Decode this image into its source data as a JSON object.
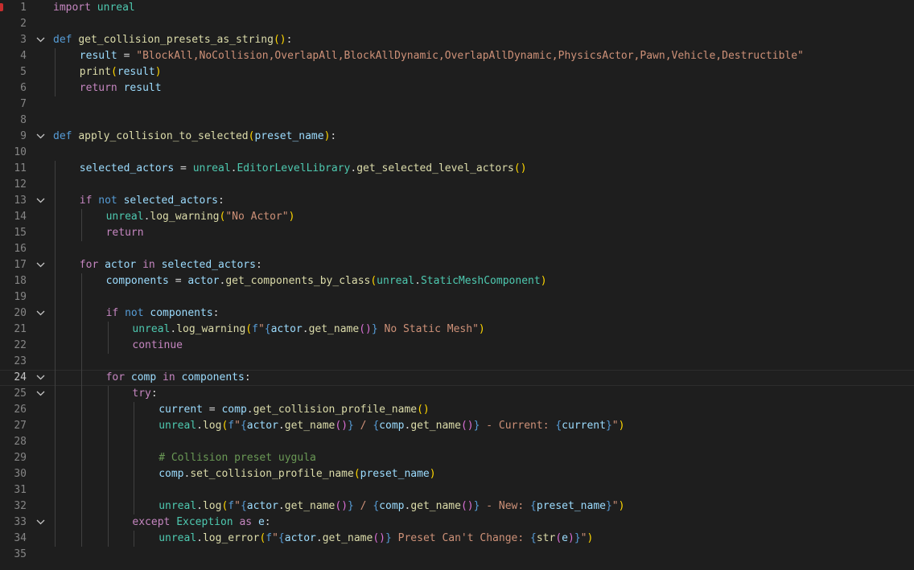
{
  "editor": {
    "language": "python",
    "active_line": 24,
    "breakpoint_line": 1,
    "lines": [
      {
        "n": 1,
        "indent": 0,
        "fold": false,
        "tokens": [
          [
            "ctl",
            "import"
          ],
          [
            "pl",
            " "
          ],
          [
            "cls",
            "unreal"
          ]
        ]
      },
      {
        "n": 2,
        "indent": 0,
        "fold": false,
        "tokens": []
      },
      {
        "n": 3,
        "indent": 0,
        "fold": true,
        "tokens": [
          [
            "kw",
            "def"
          ],
          [
            "pl",
            " "
          ],
          [
            "fn",
            "get_collision_presets_as_string"
          ],
          [
            "b1",
            "()"
          ],
          [
            "pl",
            ":"
          ]
        ]
      },
      {
        "n": 4,
        "indent": 1,
        "fold": false,
        "tokens": [
          [
            "var",
            "result"
          ],
          [
            "pl",
            " = "
          ],
          [
            "str",
            "\"BlockAll,NoCollision,OverlapAll,BlockAllDynamic,OverlapAllDynamic,PhysicsActor,Pawn,Vehicle,Destructible\""
          ]
        ]
      },
      {
        "n": 5,
        "indent": 1,
        "fold": false,
        "tokens": [
          [
            "fn",
            "print"
          ],
          [
            "b1",
            "("
          ],
          [
            "var",
            "result"
          ],
          [
            "b1",
            ")"
          ]
        ]
      },
      {
        "n": 6,
        "indent": 1,
        "fold": false,
        "tokens": [
          [
            "ctl",
            "return"
          ],
          [
            "pl",
            " "
          ],
          [
            "var",
            "result"
          ]
        ]
      },
      {
        "n": 7,
        "indent": 0,
        "fold": false,
        "tokens": []
      },
      {
        "n": 8,
        "indent": 0,
        "fold": false,
        "tokens": []
      },
      {
        "n": 9,
        "indent": 0,
        "fold": true,
        "tokens": [
          [
            "kw",
            "def"
          ],
          [
            "pl",
            " "
          ],
          [
            "fn",
            "apply_collision_to_selected"
          ],
          [
            "b1",
            "("
          ],
          [
            "var",
            "preset_name"
          ],
          [
            "b1",
            ")"
          ],
          [
            "pl",
            ":"
          ]
        ]
      },
      {
        "n": 10,
        "indent": 0,
        "fold": false,
        "tokens": []
      },
      {
        "n": 11,
        "indent": 1,
        "fold": false,
        "tokens": [
          [
            "var",
            "selected_actors"
          ],
          [
            "pl",
            " = "
          ],
          [
            "cls",
            "unreal"
          ],
          [
            "pl",
            "."
          ],
          [
            "cls",
            "EditorLevelLibrary"
          ],
          [
            "pl",
            "."
          ],
          [
            "fn",
            "get_selected_level_actors"
          ],
          [
            "b1",
            "()"
          ]
        ]
      },
      {
        "n": 12,
        "indent": 0,
        "fold": false,
        "tokens": []
      },
      {
        "n": 13,
        "indent": 1,
        "fold": true,
        "tokens": [
          [
            "ctl",
            "if"
          ],
          [
            "pl",
            " "
          ],
          [
            "kw",
            "not"
          ],
          [
            "pl",
            " "
          ],
          [
            "var",
            "selected_actors"
          ],
          [
            "pl",
            ":"
          ]
        ]
      },
      {
        "n": 14,
        "indent": 2,
        "fold": false,
        "tokens": [
          [
            "cls",
            "unreal"
          ],
          [
            "pl",
            "."
          ],
          [
            "fn",
            "log_warning"
          ],
          [
            "b1",
            "("
          ],
          [
            "str",
            "\"No Actor\""
          ],
          [
            "b1",
            ")"
          ]
        ]
      },
      {
        "n": 15,
        "indent": 2,
        "fold": false,
        "tokens": [
          [
            "ctl",
            "return"
          ]
        ]
      },
      {
        "n": 16,
        "indent": 0,
        "fold": false,
        "tokens": []
      },
      {
        "n": 17,
        "indent": 1,
        "fold": true,
        "tokens": [
          [
            "ctl",
            "for"
          ],
          [
            "pl",
            " "
          ],
          [
            "var",
            "actor"
          ],
          [
            "pl",
            " "
          ],
          [
            "ctl",
            "in"
          ],
          [
            "pl",
            " "
          ],
          [
            "var",
            "selected_actors"
          ],
          [
            "pl",
            ":"
          ]
        ]
      },
      {
        "n": 18,
        "indent": 2,
        "fold": false,
        "tokens": [
          [
            "var",
            "components"
          ],
          [
            "pl",
            " = "
          ],
          [
            "var",
            "actor"
          ],
          [
            "pl",
            "."
          ],
          [
            "fn",
            "get_components_by_class"
          ],
          [
            "b1",
            "("
          ],
          [
            "cls",
            "unreal"
          ],
          [
            "pl",
            "."
          ],
          [
            "cls",
            "StaticMeshComponent"
          ],
          [
            "b1",
            ")"
          ]
        ]
      },
      {
        "n": 19,
        "indent": 0,
        "fold": false,
        "tokens": []
      },
      {
        "n": 20,
        "indent": 2,
        "fold": true,
        "tokens": [
          [
            "ctl",
            "if"
          ],
          [
            "pl",
            " "
          ],
          [
            "kw",
            "not"
          ],
          [
            "pl",
            " "
          ],
          [
            "var",
            "components"
          ],
          [
            "pl",
            ":"
          ]
        ]
      },
      {
        "n": 21,
        "indent": 3,
        "fold": false,
        "tokens": [
          [
            "cls",
            "unreal"
          ],
          [
            "pl",
            "."
          ],
          [
            "fn",
            "log_warning"
          ],
          [
            "b1",
            "("
          ],
          [
            "kw",
            "f"
          ],
          [
            "str",
            "\""
          ],
          [
            "kw",
            "{"
          ],
          [
            "var",
            "actor"
          ],
          [
            "pl",
            "."
          ],
          [
            "fn",
            "get_name"
          ],
          [
            "b2",
            "()"
          ],
          [
            "kw",
            "}"
          ],
          [
            "str",
            " No Static Mesh\""
          ],
          [
            "b1",
            ")"
          ]
        ]
      },
      {
        "n": 22,
        "indent": 3,
        "fold": false,
        "tokens": [
          [
            "ctl",
            "continue"
          ]
        ]
      },
      {
        "n": 23,
        "indent": 0,
        "fold": false,
        "tokens": []
      },
      {
        "n": 24,
        "indent": 2,
        "fold": true,
        "tokens": [
          [
            "ctl",
            "for"
          ],
          [
            "pl",
            " "
          ],
          [
            "var",
            "comp"
          ],
          [
            "pl",
            " "
          ],
          [
            "ctl",
            "in"
          ],
          [
            "pl",
            " "
          ],
          [
            "var",
            "components"
          ],
          [
            "pl",
            ":"
          ]
        ]
      },
      {
        "n": 25,
        "indent": 3,
        "fold": true,
        "tokens": [
          [
            "ctl",
            "try"
          ],
          [
            "pl",
            ":"
          ]
        ]
      },
      {
        "n": 26,
        "indent": 4,
        "fold": false,
        "tokens": [
          [
            "var",
            "current"
          ],
          [
            "pl",
            " = "
          ],
          [
            "var",
            "comp"
          ],
          [
            "pl",
            "."
          ],
          [
            "fn",
            "get_collision_profile_name"
          ],
          [
            "b1",
            "()"
          ]
        ]
      },
      {
        "n": 27,
        "indent": 4,
        "fold": false,
        "tokens": [
          [
            "cls",
            "unreal"
          ],
          [
            "pl",
            "."
          ],
          [
            "fn",
            "log"
          ],
          [
            "b1",
            "("
          ],
          [
            "kw",
            "f"
          ],
          [
            "str",
            "\""
          ],
          [
            "kw",
            "{"
          ],
          [
            "var",
            "actor"
          ],
          [
            "pl",
            "."
          ],
          [
            "fn",
            "get_name"
          ],
          [
            "b2",
            "()"
          ],
          [
            "kw",
            "}"
          ],
          [
            "str",
            " / "
          ],
          [
            "kw",
            "{"
          ],
          [
            "var",
            "comp"
          ],
          [
            "pl",
            "."
          ],
          [
            "fn",
            "get_name"
          ],
          [
            "b2",
            "()"
          ],
          [
            "kw",
            "}"
          ],
          [
            "str",
            " - Current: "
          ],
          [
            "kw",
            "{"
          ],
          [
            "var",
            "current"
          ],
          [
            "kw",
            "}"
          ],
          [
            "str",
            "\""
          ],
          [
            "b1",
            ")"
          ]
        ]
      },
      {
        "n": 28,
        "indent": 0,
        "fold": false,
        "tokens": []
      },
      {
        "n": 29,
        "indent": 4,
        "fold": false,
        "tokens": [
          [
            "com",
            "# Collision preset uygula"
          ]
        ]
      },
      {
        "n": 30,
        "indent": 4,
        "fold": false,
        "tokens": [
          [
            "var",
            "comp"
          ],
          [
            "pl",
            "."
          ],
          [
            "fn",
            "set_collision_profile_name"
          ],
          [
            "b1",
            "("
          ],
          [
            "var",
            "preset_name"
          ],
          [
            "b1",
            ")"
          ]
        ]
      },
      {
        "n": 31,
        "indent": 0,
        "fold": false,
        "tokens": []
      },
      {
        "n": 32,
        "indent": 4,
        "fold": false,
        "tokens": [
          [
            "cls",
            "unreal"
          ],
          [
            "pl",
            "."
          ],
          [
            "fn",
            "log"
          ],
          [
            "b1",
            "("
          ],
          [
            "kw",
            "f"
          ],
          [
            "str",
            "\""
          ],
          [
            "kw",
            "{"
          ],
          [
            "var",
            "actor"
          ],
          [
            "pl",
            "."
          ],
          [
            "fn",
            "get_name"
          ],
          [
            "b2",
            "()"
          ],
          [
            "kw",
            "}"
          ],
          [
            "str",
            " / "
          ],
          [
            "kw",
            "{"
          ],
          [
            "var",
            "comp"
          ],
          [
            "pl",
            "."
          ],
          [
            "fn",
            "get_name"
          ],
          [
            "b2",
            "()"
          ],
          [
            "kw",
            "}"
          ],
          [
            "str",
            " - New: "
          ],
          [
            "kw",
            "{"
          ],
          [
            "var",
            "preset_name"
          ],
          [
            "kw",
            "}"
          ],
          [
            "str",
            "\""
          ],
          [
            "b1",
            ")"
          ]
        ]
      },
      {
        "n": 33,
        "indent": 3,
        "fold": true,
        "tokens": [
          [
            "ctl",
            "except"
          ],
          [
            "pl",
            " "
          ],
          [
            "cls",
            "Exception"
          ],
          [
            "pl",
            " "
          ],
          [
            "ctl",
            "as"
          ],
          [
            "pl",
            " "
          ],
          [
            "var",
            "e"
          ],
          [
            "pl",
            ":"
          ]
        ]
      },
      {
        "n": 34,
        "indent": 4,
        "fold": false,
        "tokens": [
          [
            "cls",
            "unreal"
          ],
          [
            "pl",
            "."
          ],
          [
            "fn",
            "log_error"
          ],
          [
            "b1",
            "("
          ],
          [
            "kw",
            "f"
          ],
          [
            "str",
            "\""
          ],
          [
            "kw",
            "{"
          ],
          [
            "var",
            "actor"
          ],
          [
            "pl",
            "."
          ],
          [
            "fn",
            "get_name"
          ],
          [
            "b2",
            "()"
          ],
          [
            "kw",
            "}"
          ],
          [
            "str",
            " Preset Can't Change: "
          ],
          [
            "kw",
            "{"
          ],
          [
            "fn",
            "str"
          ],
          [
            "b2",
            "("
          ],
          [
            "var",
            "e"
          ],
          [
            "b2",
            ")"
          ],
          [
            "kw",
            "}"
          ],
          [
            "str",
            "\""
          ],
          [
            "b1",
            ")"
          ]
        ]
      },
      {
        "n": 35,
        "indent": 0,
        "fold": false,
        "tokens": []
      }
    ]
  }
}
